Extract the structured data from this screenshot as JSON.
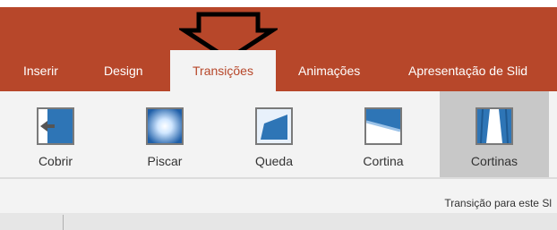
{
  "colors": {
    "accent": "#b7472a",
    "ribbon_bg": "#f3f3f3",
    "selected_bg": "#c8c8c8",
    "thumb_blue": "#2e75b6"
  },
  "tabs": [
    {
      "label": "Inserir",
      "active": false
    },
    {
      "label": "Design",
      "active": false
    },
    {
      "label": "Transições",
      "active": true
    },
    {
      "label": "Animações",
      "active": false
    },
    {
      "label": "Apresentação de Slid",
      "active": false
    }
  ],
  "transitions": [
    {
      "label": "Cobrir",
      "icon": "cover-transition-icon",
      "selected": false
    },
    {
      "label": "Piscar",
      "icon": "flash-transition-icon",
      "selected": false
    },
    {
      "label": "Queda",
      "icon": "fall-over-transition-icon",
      "selected": false
    },
    {
      "label": "Cortina",
      "icon": "drape-transition-icon",
      "selected": false
    },
    {
      "label": "Cortinas",
      "icon": "curtains-transition-icon",
      "selected": true
    }
  ],
  "group": {
    "label": "Transição para este Sl"
  }
}
